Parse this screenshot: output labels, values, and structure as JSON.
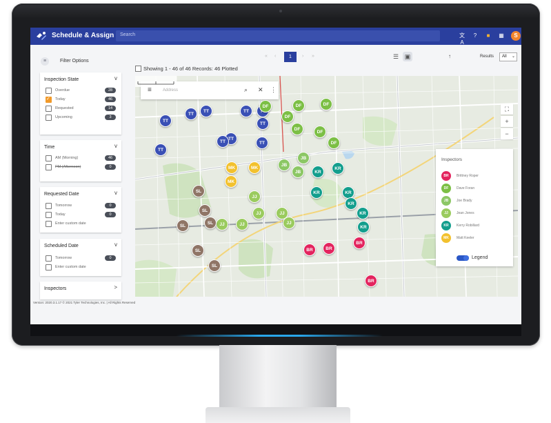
{
  "app": {
    "title": "Schedule & Assign",
    "search_placeholder": "Search",
    "avatar_initial": "S"
  },
  "topbar_icons": [
    "translate-icon",
    "help-icon",
    "badge-icon",
    "apps-grid-icon"
  ],
  "sidebar": {
    "header": "Filter Options",
    "cards": [
      {
        "title": "Inspection State",
        "chevron": "v",
        "items": [
          {
            "label": "Overdue",
            "count": "28",
            "checked": false
          },
          {
            "label": "Today",
            "count": "46",
            "checked": true
          },
          {
            "label": "Requested",
            "count": "14",
            "checked": false
          },
          {
            "label": "Upcoming",
            "count": "3",
            "checked": false
          }
        ]
      },
      {
        "title": "Time",
        "chevron": "v",
        "items": [
          {
            "label": "AM (Morning)",
            "count": "46",
            "checked": false
          },
          {
            "label": "PM (Afternoon)",
            "count": "0",
            "checked": false
          }
        ]
      },
      {
        "title": "Requested Date",
        "chevron": "v",
        "items": [
          {
            "label": "Tomorrow",
            "count": "0",
            "checked": false
          },
          {
            "label": "Today",
            "count": "0",
            "checked": false
          },
          {
            "label": "Enter custom date",
            "count": "",
            "checked": false
          }
        ]
      },
      {
        "title": "Scheduled Date",
        "chevron": "v",
        "items": [
          {
            "label": "Tomorrow",
            "count": "0",
            "checked": false
          },
          {
            "label": "Enter custom date",
            "count": "",
            "checked": false
          }
        ]
      },
      {
        "title": "Inspectors",
        "chevron": ">",
        "items": []
      }
    ]
  },
  "footer": {
    "version": "Version: 2020.3.1.17   © 2021 Tyler Technologies, Inc.  |  All Rights Reserved"
  },
  "results": {
    "showing": "Showing 1 - 46 of 46 Records: 46 Plotted",
    "page": "1",
    "results_label": "Results",
    "results_value": "All"
  },
  "map": {
    "search_placeholder": "Address",
    "pins": [
      {
        "initials": "TT",
        "color": "#3a50b5"
      },
      {
        "initials": "TT",
        "color": "#3a50b5"
      },
      {
        "initials": "TT",
        "color": "#3a50b5"
      },
      {
        "initials": "TT",
        "color": "#3a50b5"
      },
      {
        "initials": "TT",
        "color": "#3a50b5"
      },
      {
        "initials": "TT",
        "color": "#3a50b5"
      },
      {
        "initials": "TT",
        "color": "#3a50b5"
      },
      {
        "initials": "TT",
        "color": "#3a50b5"
      },
      {
        "initials": "TT",
        "color": "#3a50b5"
      },
      {
        "initials": "TT",
        "color": "#3a50b5"
      },
      {
        "initials": "DF",
        "color": "#7cbf45"
      },
      {
        "initials": "DF",
        "color": "#7cbf45"
      },
      {
        "initials": "DF",
        "color": "#7cbf45"
      },
      {
        "initials": "DF",
        "color": "#7cbf45"
      },
      {
        "initials": "DF",
        "color": "#7cbf45"
      },
      {
        "initials": "DF",
        "color": "#7cbf45"
      },
      {
        "initials": "DF",
        "color": "#7cbf45"
      },
      {
        "initials": "JB",
        "color": "#8cc765"
      },
      {
        "initials": "JB",
        "color": "#8cc765"
      },
      {
        "initials": "JB",
        "color": "#8cc765"
      },
      {
        "initials": "JJ",
        "color": "#9acb5e"
      },
      {
        "initials": "JJ",
        "color": "#9acb5e"
      },
      {
        "initials": "JJ",
        "color": "#9acb5e"
      },
      {
        "initials": "JJ",
        "color": "#9acb5e"
      },
      {
        "initials": "JJ",
        "color": "#9acb5e"
      },
      {
        "initials": "JJ",
        "color": "#9acb5e"
      },
      {
        "initials": "MK",
        "color": "#f2c12e"
      },
      {
        "initials": "MK",
        "color": "#f2c12e"
      },
      {
        "initials": "MK",
        "color": "#f2c12e"
      },
      {
        "initials": "KR",
        "color": "#139e8d"
      },
      {
        "initials": "KR",
        "color": "#139e8d"
      },
      {
        "initials": "KR",
        "color": "#139e8d"
      },
      {
        "initials": "KR",
        "color": "#139e8d"
      },
      {
        "initials": "KR",
        "color": "#139e8d"
      },
      {
        "initials": "KR",
        "color": "#139e8d"
      },
      {
        "initials": "KR",
        "color": "#139e8d"
      },
      {
        "initials": "SL",
        "color": "#8f7566"
      },
      {
        "initials": "SL",
        "color": "#8f7566"
      },
      {
        "initials": "SL",
        "color": "#8f7566"
      },
      {
        "initials": "SL",
        "color": "#8f7566"
      },
      {
        "initials": "SL",
        "color": "#8f7566"
      },
      {
        "initials": "SL",
        "color": "#8f7566"
      },
      {
        "initials": "BR",
        "color": "#e3245e"
      },
      {
        "initials": "BR",
        "color": "#e3245e"
      },
      {
        "initials": "BR",
        "color": "#e3245e"
      },
      {
        "initials": "BR",
        "color": "#e3245e"
      }
    ]
  },
  "legend": {
    "title": "Inspectors",
    "items": [
      {
        "initials": "BR",
        "name": "Brittney Roper",
        "color": "#e3245e"
      },
      {
        "initials": "DF",
        "name": "Dave Foran",
        "color": "#7cbf45"
      },
      {
        "initials": "JB",
        "name": "Joe Brady",
        "color": "#8cc765"
      },
      {
        "initials": "JJ",
        "name": "Jean Jones",
        "color": "#9acb5e"
      },
      {
        "initials": "KR",
        "name": "Kerry Robillard",
        "color": "#139e8d"
      },
      {
        "initials": "MK",
        "name": "Matt Keeler",
        "color": "#f2c12e"
      }
    ],
    "toggle_label": "Legend"
  }
}
